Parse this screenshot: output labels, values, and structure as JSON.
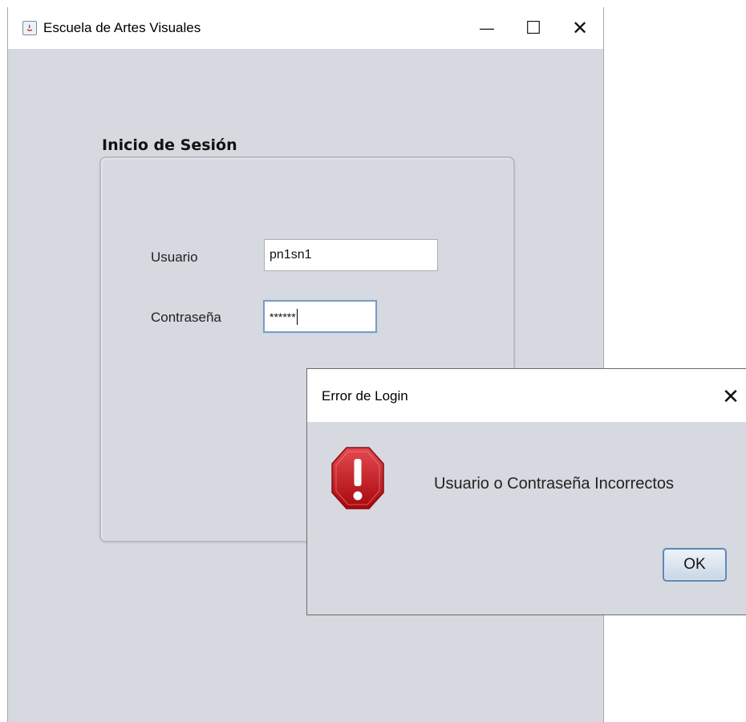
{
  "window": {
    "title": "Escuela de Artes Visuales",
    "icon": "java-app-icon",
    "controls": {
      "minimize": "—",
      "maximize": "☐",
      "close": "✕"
    }
  },
  "login": {
    "group_title": "Inicio de Sesión",
    "user_label": "Usuario",
    "user_value": "pn1sn1",
    "password_label": "Contraseña",
    "password_value": "******"
  },
  "dialog": {
    "title": "Error de Login",
    "close": "✕",
    "icon": "error-stop-icon",
    "message": "Usuario o Contraseña Incorrectos",
    "ok_label": "OK"
  },
  "colors": {
    "window_bg": "#d6d9df",
    "titlebar_bg": "#ffffff",
    "error_red": "#c8161c",
    "focus_blue": "#7a9cc6"
  }
}
